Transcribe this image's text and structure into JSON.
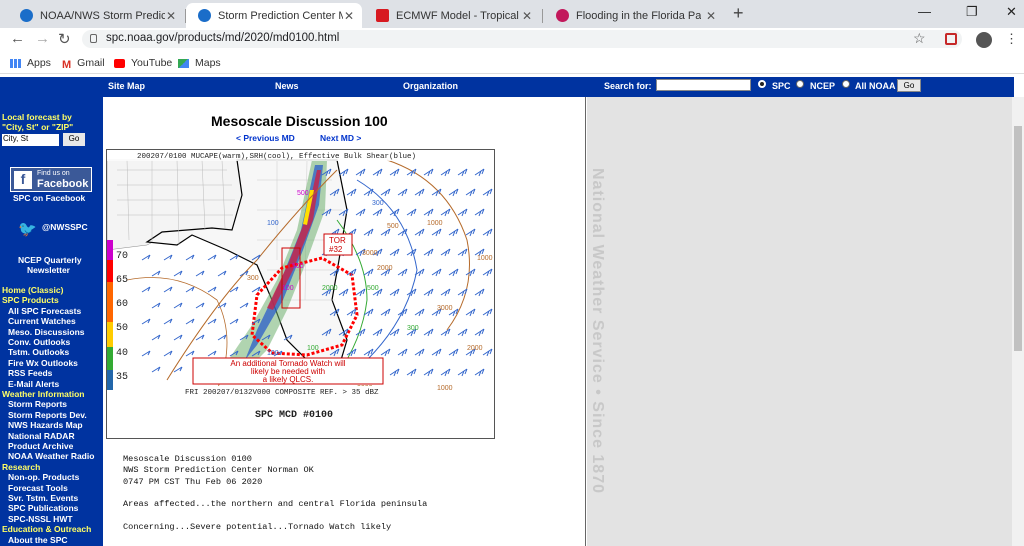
{
  "browser": {
    "tabs": [
      {
        "title": "NOAA/NWS Storm Prediction Ce",
        "icon": "noaa-icon",
        "active": false
      },
      {
        "title": "Storm Prediction Center Mesosc",
        "icon": "noaa-icon",
        "active": true
      },
      {
        "title": "ECMWF Model - Tropical Tidbits",
        "icon": "tidbits-icon",
        "active": false
      },
      {
        "title": "Flooding in the Florida Panhandl",
        "icon": "flower-icon",
        "active": false
      }
    ],
    "url": "spc.noaa.gov/products/md/2020/md0100.html",
    "bookmarks": [
      "Apps",
      "Gmail",
      "YouTube",
      "Maps"
    ]
  },
  "header": {
    "site_map": "Site Map",
    "news": "News",
    "organization": "Organization",
    "search_for": "Search for:",
    "radio_spc": "SPC",
    "radio_ncep": "NCEP",
    "radio_noaa": "All NOAA",
    "go": "Go"
  },
  "sidebar": {
    "local_title_1": "Local forecast by",
    "local_title_2": "\"City, St\" or \"ZIP\"",
    "local_value": "City, St",
    "go": "Go",
    "fb_line1": "Find us on",
    "fb_line2": "Facebook",
    "spc_facebook": "SPC on Facebook",
    "twitter": "@NWSSPC",
    "newsletter_1": "NCEP Quarterly",
    "newsletter_2": "Newsletter",
    "links": [
      {
        "text": "Home (Classic)",
        "cls": "yel",
        "indent": 2
      },
      {
        "text": "SPC Products",
        "cls": "yel",
        "indent": 2
      },
      {
        "text": "All SPC Forecasts",
        "cls": "",
        "indent": 8
      },
      {
        "text": "Current Watches",
        "cls": "",
        "indent": 8
      },
      {
        "text": "Meso. Discussions",
        "cls": "",
        "indent": 8
      },
      {
        "text": "Conv. Outlooks",
        "cls": "",
        "indent": 8
      },
      {
        "text": "Tstm. Outlooks",
        "cls": "",
        "indent": 8
      },
      {
        "text": "Fire Wx Outlooks",
        "cls": "",
        "indent": 8
      },
      {
        "text": "RSS Feeds",
        "cls": "",
        "indent": 8
      },
      {
        "text": "E-Mail Alerts",
        "cls": "",
        "indent": 8
      },
      {
        "text": "Weather Information",
        "cls": "yel",
        "indent": 2
      },
      {
        "text": "Storm Reports",
        "cls": "",
        "indent": 8
      },
      {
        "text": "Storm Reports Dev.",
        "cls": "",
        "indent": 8
      },
      {
        "text": "NWS Hazards Map",
        "cls": "",
        "indent": 8
      },
      {
        "text": "National RADAR",
        "cls": "",
        "indent": 8
      },
      {
        "text": "Product Archive",
        "cls": "",
        "indent": 8
      },
      {
        "text": "NOAA Weather Radio",
        "cls": "",
        "indent": 8
      },
      {
        "text": "Research",
        "cls": "yel",
        "indent": 2
      },
      {
        "text": "Non-op. Products",
        "cls": "",
        "indent": 8
      },
      {
        "text": "Forecast Tools",
        "cls": "",
        "indent": 8
      },
      {
        "text": "Svr. Tstm. Events",
        "cls": "",
        "indent": 8
      },
      {
        "text": "SPC Publications",
        "cls": "",
        "indent": 8
      },
      {
        "text": "SPC-NSSL HWT",
        "cls": "",
        "indent": 8
      },
      {
        "text": "Education & Outreach",
        "cls": "yel",
        "indent": 2
      },
      {
        "text": "About the SPC",
        "cls": "",
        "indent": 8
      }
    ]
  },
  "main": {
    "title": "Mesoscale Discussion 100",
    "prev": "< Previous MD",
    "next": "Next MD >",
    "map": {
      "header": "200207/0100 MUCAPE(warm),SRH(cool), Effective Bulk Shear(blue)",
      "footer": "FRI 200207/0132V000   COMPOSITE REF. > 35 dBZ",
      "caption": "SPC MCD #0100",
      "tor_1": "TOR",
      "tor_2": "#32",
      "note_1": "An additional Tornado Watch will",
      "note_2": "likely be needed with",
      "note_3": "a likely QLCS.",
      "scale": [
        "70",
        "65",
        "60",
        "50",
        "40",
        "35"
      ],
      "labels": [
        "500",
        "300",
        "100",
        "500",
        "1000",
        "3000",
        "2000",
        "500",
        "300",
        "100",
        "2000",
        "500",
        "300",
        "100",
        "100",
        "1000",
        "2000",
        "3000",
        "2000",
        "1000"
      ]
    },
    "text": [
      "Mesoscale Discussion 0100",
      "NWS Storm Prediction Center Norman OK",
      "0747 PM CST Thu Feb 06 2020",
      "",
      "Areas affected...the northern and central Florida peninsula",
      "",
      "Concerning...Severe potential...Tornado Watch likely"
    ]
  },
  "right_panel": {
    "vertical_text": "National Weather Service • Since 1870"
  },
  "colors": {
    "nws_blue": "#0033a0",
    "panel_gray": "#e3e3e3"
  }
}
